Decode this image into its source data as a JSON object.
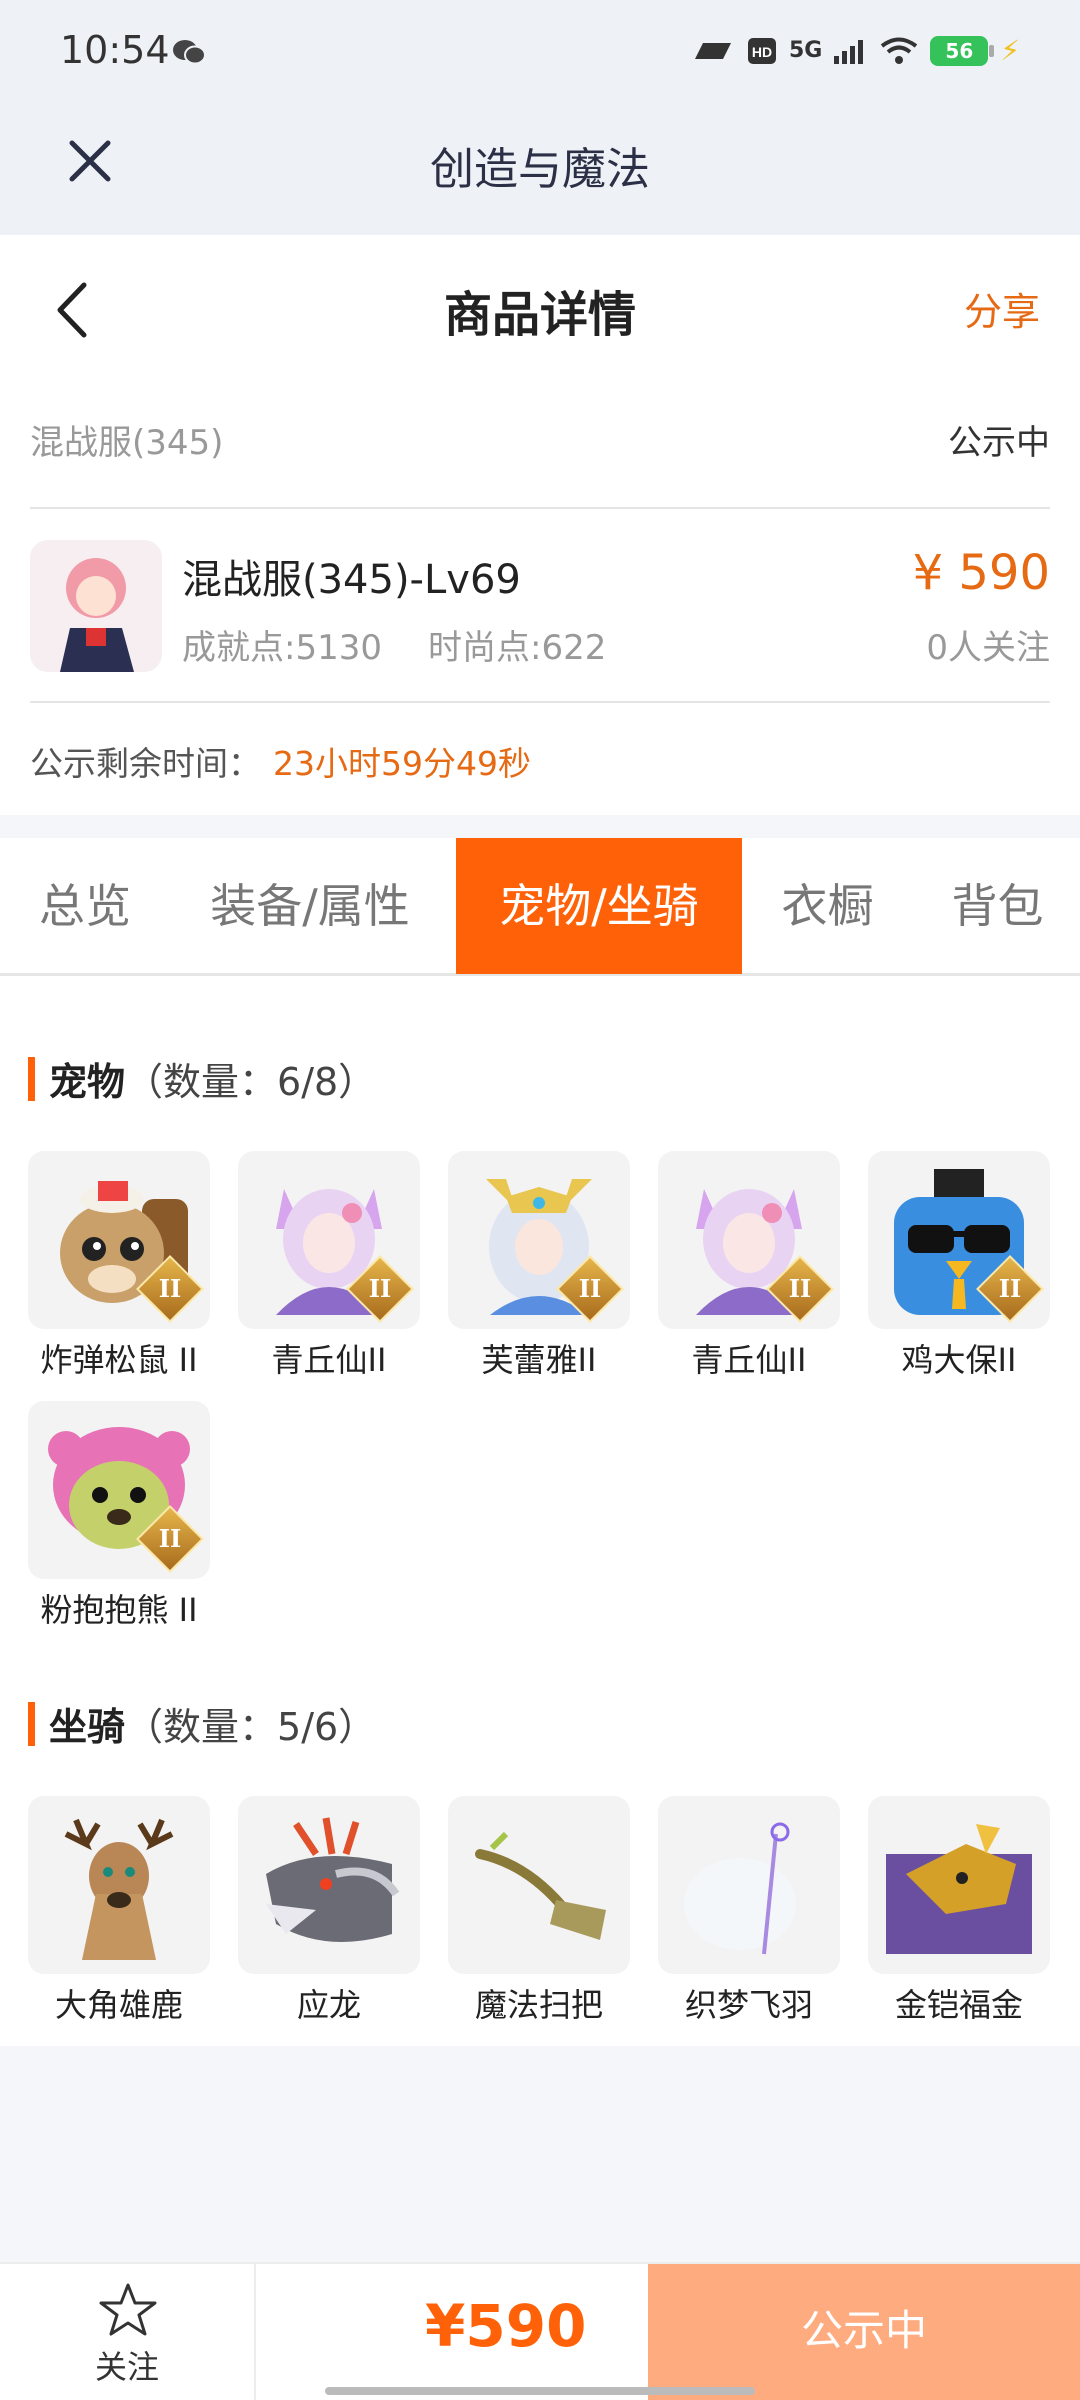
{
  "status_bar": {
    "time": "10:54",
    "network": "5G",
    "battery": "56"
  },
  "app_bar": {
    "title": "创造与魔法"
  },
  "header": {
    "title": "商品详情",
    "share_label": "分享"
  },
  "listing": {
    "server": "混战服(345)",
    "status": "公示中",
    "item_title": "混战服(345)-Lv69",
    "achievement": "成就点:5130",
    "fashion": "时尚点:622",
    "price": "¥ 590",
    "followers": "0人关注",
    "remain_label": "公示剩余时间：",
    "remain_time": "23小时59分49秒"
  },
  "tabs": [
    {
      "label": "总览",
      "active": false
    },
    {
      "label": "装备/属性",
      "active": false
    },
    {
      "label": "宠物/坐骑",
      "active": true
    },
    {
      "label": "衣橱",
      "active": false
    },
    {
      "label": "背包",
      "active": false
    }
  ],
  "pets": {
    "title": "宠物",
    "count": "（数量：6/8）",
    "items": [
      {
        "name": "炸弹松鼠 II",
        "badge": "II",
        "icon": "squirrel-icon",
        "color": "#c9a06a"
      },
      {
        "name": "青丘仙II",
        "badge": "II",
        "icon": "fox-fairy-icon",
        "color": "#d7b5e8"
      },
      {
        "name": "芙蕾雅II",
        "badge": "II",
        "icon": "valkyrie-icon",
        "color": "#e8dfa6"
      },
      {
        "name": "青丘仙II",
        "badge": "II",
        "icon": "fox-fairy-icon",
        "color": "#d7b5e8"
      },
      {
        "name": "鸡大保II",
        "badge": "II",
        "icon": "blue-bird-icon",
        "color": "#3a8ee0"
      },
      {
        "name": "粉抱抱熊 II",
        "badge": "II",
        "icon": "pink-bear-icon",
        "color": "#e773b6"
      }
    ]
  },
  "mounts": {
    "title": "坐骑",
    "count": "（数量：5/6）",
    "items": [
      {
        "name": "大角雄鹿",
        "icon": "stag-icon",
        "color": "#b98656"
      },
      {
        "name": "应龙",
        "icon": "dragon-icon",
        "color": "#6b6b75"
      },
      {
        "name": "魔法扫把",
        "icon": "broom-icon",
        "color": "#8a7a3a"
      },
      {
        "name": "织梦飞羽",
        "icon": "feather-icon",
        "color": "#e8eef3"
      },
      {
        "name": "金铠福金",
        "icon": "golden-beast-icon",
        "color": "#6a4fa0"
      }
    ]
  },
  "bottom_bar": {
    "follow_label": "关注",
    "price": "¥590",
    "status_button": "公示中"
  }
}
